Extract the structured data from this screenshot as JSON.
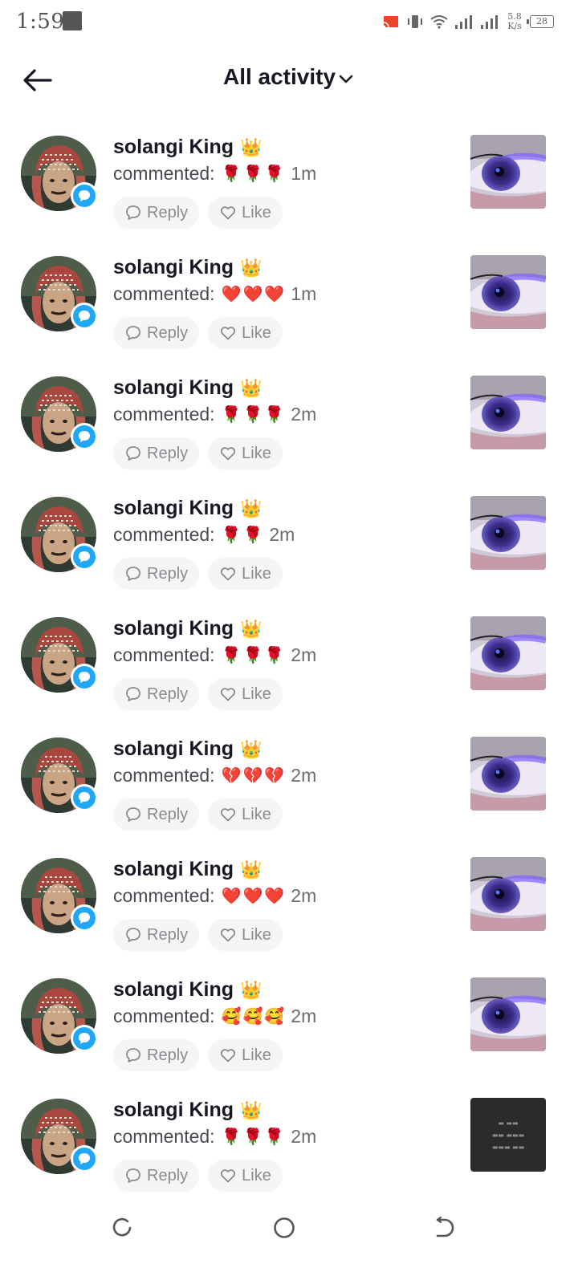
{
  "status_bar": {
    "time": "1:59",
    "net_speed_value": "5.8",
    "net_speed_unit": "K/s",
    "battery_level": "28"
  },
  "header": {
    "title": "All activity"
  },
  "labels": {
    "commented_prefix": "commented:",
    "reply": "Reply",
    "like": "Like"
  },
  "activity": [
    {
      "username": "solangi King",
      "badge_emoji": "👑",
      "emojis": "🌹🌹🌹",
      "time": "1m",
      "thumbnail": "eye-photo"
    },
    {
      "username": "solangi King",
      "badge_emoji": "👑",
      "emojis": "❤️❤️❤️",
      "time": "1m",
      "thumbnail": "eye-photo"
    },
    {
      "username": "solangi King",
      "badge_emoji": "👑",
      "emojis": "🌹🌹🌹",
      "time": "2m",
      "thumbnail": "eye-photo"
    },
    {
      "username": "solangi King",
      "badge_emoji": "👑",
      "emojis": "🌹🌹",
      "time": "2m",
      "thumbnail": "eye-photo"
    },
    {
      "username": "solangi King",
      "badge_emoji": "👑",
      "emojis": "🌹🌹🌹",
      "time": "2m",
      "thumbnail": "eye-photo"
    },
    {
      "username": "solangi King",
      "badge_emoji": "👑",
      "emojis": "💔💔💔",
      "time": "2m",
      "thumbnail": "eye-photo"
    },
    {
      "username": "solangi King",
      "badge_emoji": "👑",
      "emojis": "❤️❤️❤️",
      "time": "2m",
      "thumbnail": "eye-photo"
    },
    {
      "username": "solangi King",
      "badge_emoji": "👑",
      "emojis": "🥰🥰🥰",
      "time": "2m",
      "thumbnail": "eye-photo"
    },
    {
      "username": "solangi King",
      "badge_emoji": "👑",
      "emojis": "🌹🌹🌹",
      "time": "2m",
      "thumbnail": "dark-text-photo"
    }
  ],
  "icons": {
    "back": "arrow-left-icon",
    "dropdown": "chevron-down-icon",
    "comment_badge": "speech-bubble-icon",
    "reply": "comment-outline-icon",
    "like": "heart-outline-icon",
    "nav_recent": "recent-apps-icon",
    "nav_home": "home-circle-icon",
    "nav_back": "nav-back-icon"
  },
  "colors": {
    "badge_blue": "#20a8f6",
    "pill_bg": "#f5f5f6",
    "text_primary": "#161823",
    "text_secondary": "#4a4b52"
  }
}
